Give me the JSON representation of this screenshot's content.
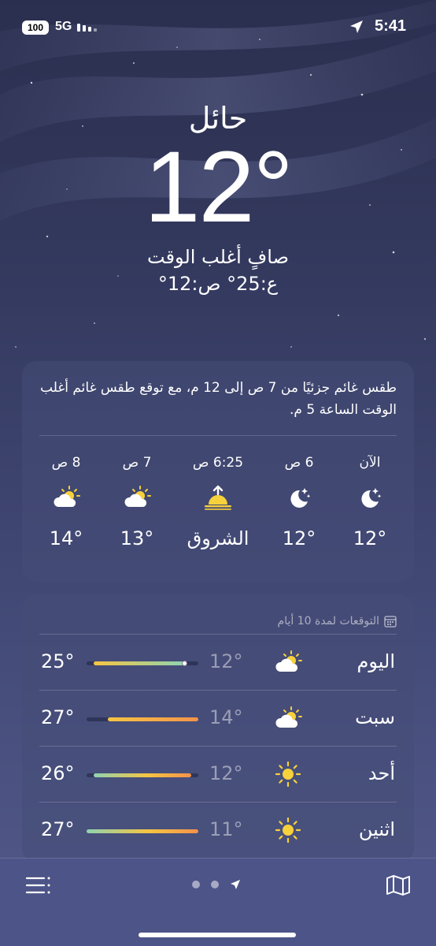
{
  "status_bar": {
    "battery": "100",
    "network": "5G",
    "time": "5:41"
  },
  "header": {
    "city": "حائل",
    "temperature": "12°",
    "condition": "صافٍ أغلب الوقت",
    "hi_lo": "ع:25°  ص:12°"
  },
  "hourly": {
    "summary": "طقس غائم جزئيًا من 7 ص إلى 12 م، مع توقع طقس غائم أغلب الوقت الساعة 5 م.",
    "items": [
      {
        "label": "الآن",
        "icon": "moon-stars-icon",
        "temp": "12°"
      },
      {
        "label": "6 ص",
        "icon": "moon-stars-icon",
        "temp": "12°"
      },
      {
        "label": "6:25 ص",
        "icon": "sunrise-icon",
        "temp": "الشروق"
      },
      {
        "label": "7 ص",
        "icon": "sun-cloud-icon",
        "temp": "13°"
      },
      {
        "label": "8 ص",
        "icon": "sun-cloud-icon",
        "temp": "14°"
      }
    ]
  },
  "forecast": {
    "title": "التوقعات لمدة 10 أيام",
    "range_min": 11,
    "range_max": 27,
    "current_temp": 12,
    "days": [
      {
        "day": "اليوم",
        "icon": "sun-cloud-icon",
        "low": "12°",
        "high": "25°",
        "low_value": 12,
        "high_value": 25
      },
      {
        "day": "سبت",
        "icon": "sun-cloud-icon",
        "low": "14°",
        "high": "27°",
        "low_value": 14,
        "high_value": 27
      },
      {
        "day": "أحد",
        "icon": "sun-icon",
        "low": "12°",
        "high": "26°",
        "low_value": 12,
        "high_value": 26
      },
      {
        "day": "اثنين",
        "icon": "sun-icon",
        "low": "11°",
        "high": "27°",
        "low_value": 11,
        "high_value": 27
      }
    ]
  },
  "colors": {
    "bar_cool": "#8fd4b0",
    "bar_warm": "#f5c542",
    "bar_hot": "#f4924a",
    "sun": "#f7d13c"
  }
}
